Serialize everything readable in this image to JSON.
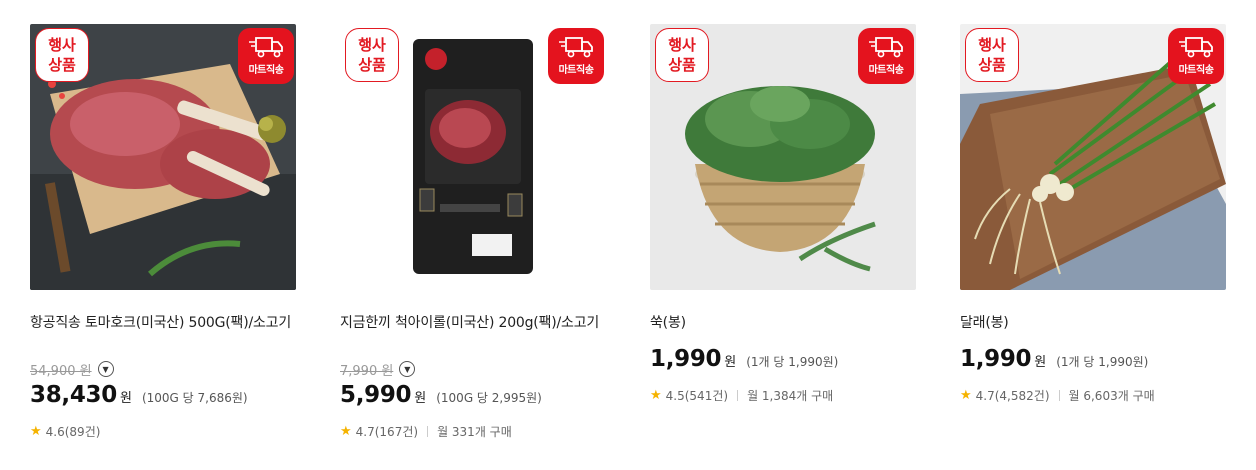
{
  "badges": {
    "event_line1": "행사",
    "event_line2": "상품",
    "mart": "마트직송"
  },
  "products": [
    {
      "title": "항공직송 토마호크(미국산) 500G(팩)/소고기",
      "original_price": "54,900 원",
      "price": "38,430",
      "currency": "원",
      "unit_price": "(100G 당 7,686원)",
      "rating": "4.6(89건)",
      "sales": ""
    },
    {
      "title": "지금한끼 척아이롤(미국산) 200g(팩)/소고기",
      "original_price": "7,990 원",
      "price": "5,990",
      "currency": "원",
      "unit_price": "(100G 당 2,995원)",
      "rating": "4.7(167건)",
      "sales": "월 331개 구매"
    },
    {
      "title": "쑥(봉)",
      "original_price": "",
      "price": "1,990",
      "currency": "원",
      "unit_price": "(1개 당 1,990원)",
      "rating": "4.5(541건)",
      "sales": "월 1,384개 구매"
    },
    {
      "title": "달래(봉)",
      "original_price": "",
      "price": "1,990",
      "currency": "원",
      "unit_price": "(1개 당 1,990원)",
      "rating": "4.7(4,582건)",
      "sales": "월 6,603개 구매"
    }
  ],
  "icons": {
    "truck": "delivery-truck-icon",
    "star": "star-icon",
    "info": "chevron-down-circle-icon"
  },
  "colors": {
    "accent": "#e4131e",
    "star": "#f5b300"
  }
}
